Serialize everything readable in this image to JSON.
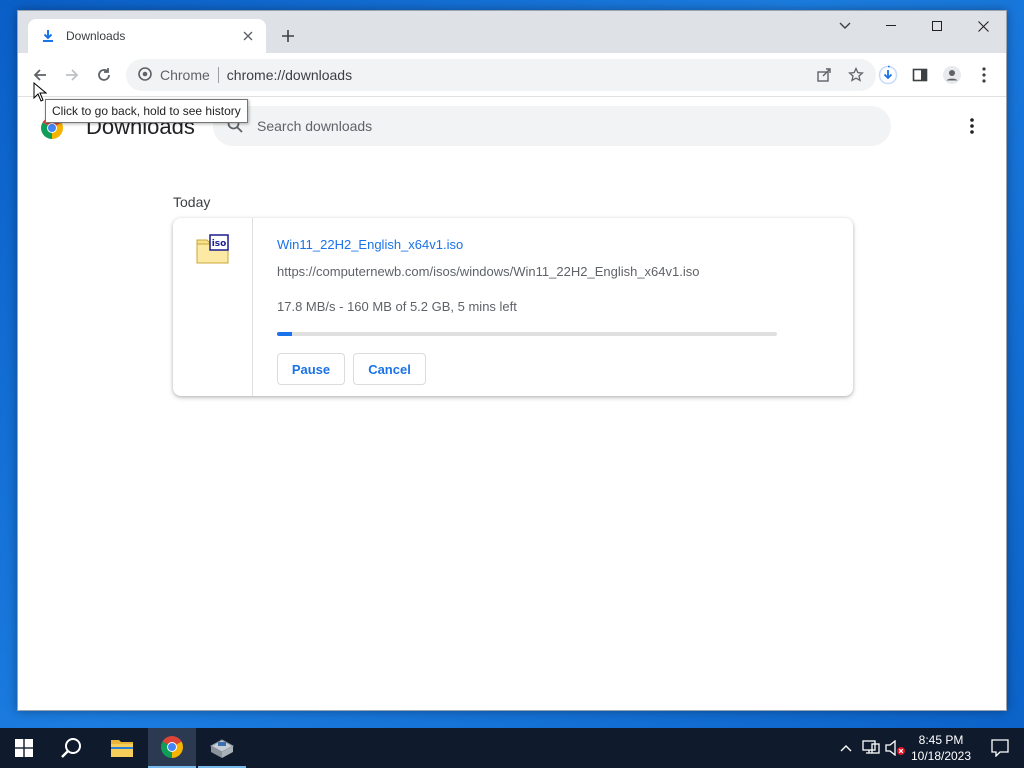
{
  "window": {
    "tab": {
      "title": "Downloads",
      "icon": "download-icon"
    },
    "controls": {
      "tab_search_icon": "chevron-down-icon",
      "minimize_icon": "minimize-icon",
      "maximize_icon": "maximize-icon",
      "close_icon": "close-icon"
    }
  },
  "toolbar": {
    "site_label": "Chrome",
    "url": "chrome://downloads",
    "tooltip": "Click to go back, hold to see history"
  },
  "downloads_page": {
    "title": "Downloads",
    "search_placeholder": "Search downloads",
    "section_label": "Today",
    "item": {
      "file_name": "Win11_22H2_English_x64v1.iso",
      "source_url": "https://computernewb.com/isos/windows/Win11_22H2_English_x64v1.iso",
      "status": "17.8 MB/s - 160 MB of 5.2 GB, 5 mins left",
      "progress_fraction": 0.03,
      "file_icon_label": "iso",
      "pause_label": "Pause",
      "cancel_label": "Cancel"
    }
  },
  "taskbar": {
    "time": "8:45 PM",
    "date": "10/18/2023"
  },
  "colors": {
    "accent": "#1a73e8",
    "desktop": "#0a5fc7",
    "taskbar": "#0f1b2d"
  }
}
